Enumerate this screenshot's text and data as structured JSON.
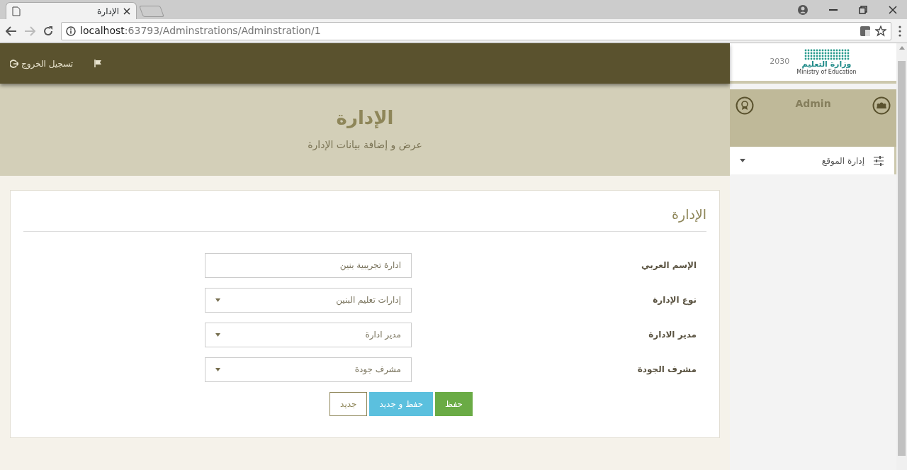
{
  "browser": {
    "tab_title": "الإدارة",
    "url_host": "localhost",
    "url_path": ":63793/Adminstrations/Adminstration/1"
  },
  "topbar": {
    "logout": "تسجيل الخروج"
  },
  "header": {
    "title": "الإدارة",
    "subtitle": "عرض و إضافة بيانات الإدارة"
  },
  "sidebar": {
    "logo": {
      "name_ar": "وزارة التعليم",
      "name_en": "Ministry of Education",
      "vision": "2030"
    },
    "user": "Admin",
    "menu": [
      {
        "label": "إدارة الموقع",
        "expanded": false
      }
    ]
  },
  "form": {
    "title": "الإدارة",
    "fields": [
      {
        "label": "الإسم العربي",
        "kind": "text",
        "value": "ادارة تجريبية بنين"
      },
      {
        "label": "نوع الإدارة",
        "kind": "select",
        "value": "إدارات تعليم البنين"
      },
      {
        "label": "مدير الادارة",
        "kind": "select",
        "value": "مدير ادارة"
      },
      {
        "label": "مشرف الجودة",
        "kind": "select",
        "value": "مشرف جودة"
      }
    ],
    "buttons": [
      {
        "label": "حفظ",
        "kind": "success"
      },
      {
        "label": "حفظ و جديد",
        "kind": "info"
      },
      {
        "label": "جديد",
        "kind": "outline"
      }
    ]
  }
}
